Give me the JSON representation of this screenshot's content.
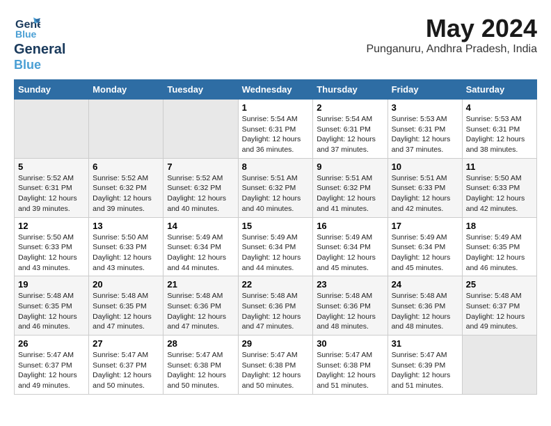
{
  "header": {
    "logo_line1": "General",
    "logo_line2": "Blue",
    "month_year": "May 2024",
    "location": "Punganuru, Andhra Pradesh, India"
  },
  "weekdays": [
    "Sunday",
    "Monday",
    "Tuesday",
    "Wednesday",
    "Thursday",
    "Friday",
    "Saturday"
  ],
  "weeks": [
    [
      {
        "day": "",
        "info": ""
      },
      {
        "day": "",
        "info": ""
      },
      {
        "day": "",
        "info": ""
      },
      {
        "day": "1",
        "info": "Sunrise: 5:54 AM\nSunset: 6:31 PM\nDaylight: 12 hours\nand 36 minutes."
      },
      {
        "day": "2",
        "info": "Sunrise: 5:54 AM\nSunset: 6:31 PM\nDaylight: 12 hours\nand 37 minutes."
      },
      {
        "day": "3",
        "info": "Sunrise: 5:53 AM\nSunset: 6:31 PM\nDaylight: 12 hours\nand 37 minutes."
      },
      {
        "day": "4",
        "info": "Sunrise: 5:53 AM\nSunset: 6:31 PM\nDaylight: 12 hours\nand 38 minutes."
      }
    ],
    [
      {
        "day": "5",
        "info": "Sunrise: 5:52 AM\nSunset: 6:31 PM\nDaylight: 12 hours\nand 39 minutes."
      },
      {
        "day": "6",
        "info": "Sunrise: 5:52 AM\nSunset: 6:32 PM\nDaylight: 12 hours\nand 39 minutes."
      },
      {
        "day": "7",
        "info": "Sunrise: 5:52 AM\nSunset: 6:32 PM\nDaylight: 12 hours\nand 40 minutes."
      },
      {
        "day": "8",
        "info": "Sunrise: 5:51 AM\nSunset: 6:32 PM\nDaylight: 12 hours\nand 40 minutes."
      },
      {
        "day": "9",
        "info": "Sunrise: 5:51 AM\nSunset: 6:32 PM\nDaylight: 12 hours\nand 41 minutes."
      },
      {
        "day": "10",
        "info": "Sunrise: 5:51 AM\nSunset: 6:33 PM\nDaylight: 12 hours\nand 42 minutes."
      },
      {
        "day": "11",
        "info": "Sunrise: 5:50 AM\nSunset: 6:33 PM\nDaylight: 12 hours\nand 42 minutes."
      }
    ],
    [
      {
        "day": "12",
        "info": "Sunrise: 5:50 AM\nSunset: 6:33 PM\nDaylight: 12 hours\nand 43 minutes."
      },
      {
        "day": "13",
        "info": "Sunrise: 5:50 AM\nSunset: 6:33 PM\nDaylight: 12 hours\nand 43 minutes."
      },
      {
        "day": "14",
        "info": "Sunrise: 5:49 AM\nSunset: 6:34 PM\nDaylight: 12 hours\nand 44 minutes."
      },
      {
        "day": "15",
        "info": "Sunrise: 5:49 AM\nSunset: 6:34 PM\nDaylight: 12 hours\nand 44 minutes."
      },
      {
        "day": "16",
        "info": "Sunrise: 5:49 AM\nSunset: 6:34 PM\nDaylight: 12 hours\nand 45 minutes."
      },
      {
        "day": "17",
        "info": "Sunrise: 5:49 AM\nSunset: 6:34 PM\nDaylight: 12 hours\nand 45 minutes."
      },
      {
        "day": "18",
        "info": "Sunrise: 5:49 AM\nSunset: 6:35 PM\nDaylight: 12 hours\nand 46 minutes."
      }
    ],
    [
      {
        "day": "19",
        "info": "Sunrise: 5:48 AM\nSunset: 6:35 PM\nDaylight: 12 hours\nand 46 minutes."
      },
      {
        "day": "20",
        "info": "Sunrise: 5:48 AM\nSunset: 6:35 PM\nDaylight: 12 hours\nand 47 minutes."
      },
      {
        "day": "21",
        "info": "Sunrise: 5:48 AM\nSunset: 6:36 PM\nDaylight: 12 hours\nand 47 minutes."
      },
      {
        "day": "22",
        "info": "Sunrise: 5:48 AM\nSunset: 6:36 PM\nDaylight: 12 hours\nand 47 minutes."
      },
      {
        "day": "23",
        "info": "Sunrise: 5:48 AM\nSunset: 6:36 PM\nDaylight: 12 hours\nand 48 minutes."
      },
      {
        "day": "24",
        "info": "Sunrise: 5:48 AM\nSunset: 6:36 PM\nDaylight: 12 hours\nand 48 minutes."
      },
      {
        "day": "25",
        "info": "Sunrise: 5:48 AM\nSunset: 6:37 PM\nDaylight: 12 hours\nand 49 minutes."
      }
    ],
    [
      {
        "day": "26",
        "info": "Sunrise: 5:47 AM\nSunset: 6:37 PM\nDaylight: 12 hours\nand 49 minutes."
      },
      {
        "day": "27",
        "info": "Sunrise: 5:47 AM\nSunset: 6:37 PM\nDaylight: 12 hours\nand 50 minutes."
      },
      {
        "day": "28",
        "info": "Sunrise: 5:47 AM\nSunset: 6:38 PM\nDaylight: 12 hours\nand 50 minutes."
      },
      {
        "day": "29",
        "info": "Sunrise: 5:47 AM\nSunset: 6:38 PM\nDaylight: 12 hours\nand 50 minutes."
      },
      {
        "day": "30",
        "info": "Sunrise: 5:47 AM\nSunset: 6:38 PM\nDaylight: 12 hours\nand 51 minutes."
      },
      {
        "day": "31",
        "info": "Sunrise: 5:47 AM\nSunset: 6:39 PM\nDaylight: 12 hours\nand 51 minutes."
      },
      {
        "day": "",
        "info": ""
      }
    ]
  ]
}
